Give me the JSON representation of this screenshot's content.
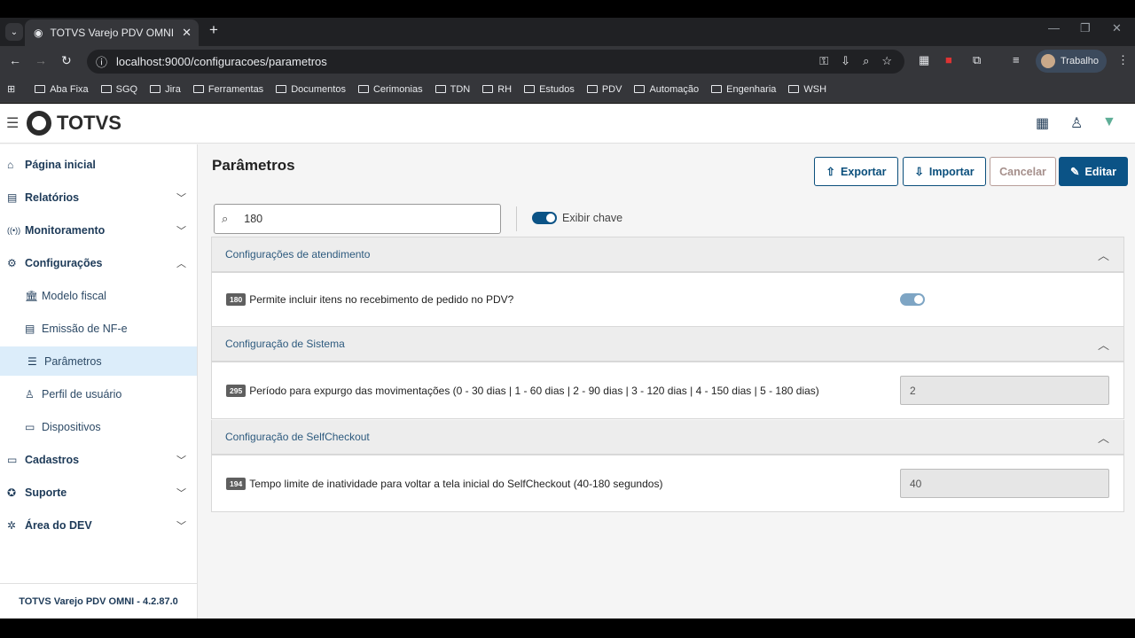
{
  "browser": {
    "tab_title": "TOTVS Varejo PDV OMNI",
    "url": "localhost:9000/configuracoes/parametros",
    "profile": "Trabalho",
    "bookmarks": [
      "Aba Fixa",
      "SGQ",
      "Jira",
      "Ferramentas",
      "Documentos",
      "Cerimonias",
      "TDN",
      "RH",
      "Estudos",
      "PDV",
      "Automação",
      "Engenharia",
      "WSH"
    ]
  },
  "app": {
    "logo": "TOTVS",
    "footer": "TOTVS Varejo PDV OMNI - 4.2.87.0"
  },
  "sidebar": {
    "items": [
      {
        "label": "Página inicial"
      },
      {
        "label": "Relatórios"
      },
      {
        "label": "Monitoramento"
      },
      {
        "label": "Configurações"
      },
      {
        "label": "Modelo fiscal"
      },
      {
        "label": "Emissão de NF-e"
      },
      {
        "label": "Parâmetros"
      },
      {
        "label": "Perfil de usuário"
      },
      {
        "label": "Dispositivos"
      },
      {
        "label": "Cadastros"
      },
      {
        "label": "Suporte"
      },
      {
        "label": "Área do DEV"
      }
    ]
  },
  "page": {
    "title": "Parâmetros",
    "export": "Exportar",
    "import": "Importar",
    "cancel": "Cancelar",
    "edit": "Editar",
    "search_value": "180",
    "show_key_label": "Exibir chave",
    "show_key_on": true
  },
  "sections": [
    {
      "title": "Configurações de atendimento",
      "params": [
        {
          "key": "180",
          "label": "Permite incluir itens no recebimento de pedido no PDV?",
          "type": "toggle",
          "value": true
        }
      ]
    },
    {
      "title": "Configuração de Sistema",
      "params": [
        {
          "key": "295",
          "label": "Período para expurgo das movimentações (0 - 30 dias | 1 - 60 dias | 2 - 90 dias | 3 - 120 dias | 4 - 150 dias | 5 - 180 dias)",
          "type": "input",
          "value": "2"
        }
      ]
    },
    {
      "title": "Configuração de SelfCheckout",
      "params": [
        {
          "key": "194",
          "label": "Tempo limite de inatividade para voltar a tela inicial do SelfCheckout (40-180 segundos)",
          "type": "input",
          "value": "40"
        }
      ]
    }
  ]
}
